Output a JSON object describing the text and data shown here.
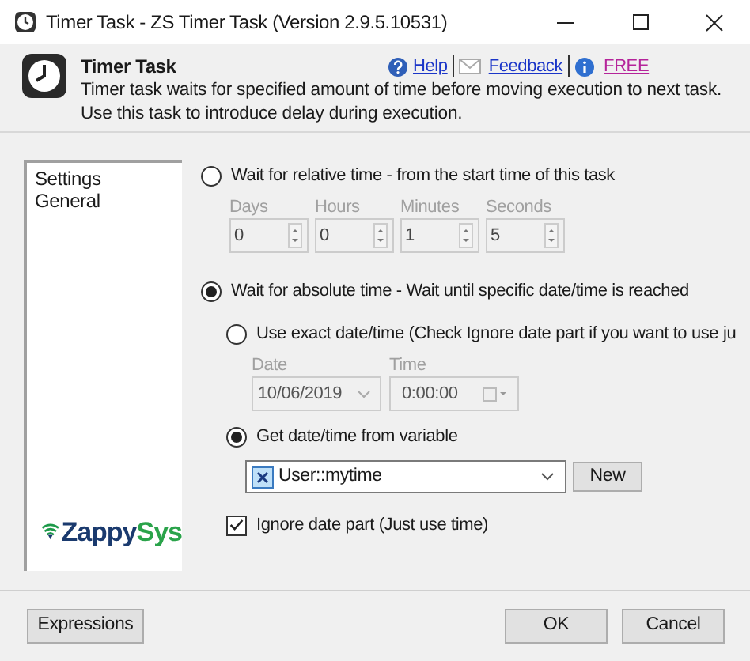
{
  "window": {
    "title": "Timer Task - ZS Timer Task (Version 2.9.5.10531)"
  },
  "header": {
    "title": "Timer Task",
    "description": "Timer task waits for specified amount of time before moving execution to next task. Use this task to introduce delay during execution.",
    "links": [
      {
        "kind": "help",
        "label": "Help"
      },
      {
        "kind": "feedback",
        "label": "Feedback"
      },
      {
        "kind": "info",
        "label": "FREE"
      }
    ]
  },
  "sidebar": {
    "items": [
      {
        "label": "Settings",
        "selected": false
      },
      {
        "label": "General",
        "selected": false
      }
    ],
    "logo": {
      "part_1": "Zappy",
      "part_2": "Sys"
    }
  },
  "relative": {
    "label": "Wait for relative time - from the start time of this task",
    "selected": false,
    "spinners": [
      {
        "label": "Days",
        "value": "0",
        "disabled": true
      },
      {
        "label": "Hours",
        "value": "0",
        "disabled": true
      },
      {
        "label": "Minutes",
        "value": "1",
        "disabled": true
      },
      {
        "label": "Seconds",
        "value": "5",
        "disabled": true
      }
    ]
  },
  "absolute": {
    "label": "Wait for absolute time - Wait until specific date/time is reached",
    "selected": true,
    "exact": {
      "label": "Use exact date/time (Check Ignore date part if you want to use ju",
      "selected": false,
      "date_label": "Date",
      "date": "10/06/2019",
      "time_label": "Time",
      "time": "0:00:00",
      "disabled": true
    },
    "variable": {
      "label": "Get date/time from variable",
      "selected": true,
      "value": "User::mytime",
      "new_button": "New"
    },
    "ignore_date": {
      "label": "Ignore date part (Just use time)",
      "checked": true
    }
  },
  "buttons": {
    "expressions": "Expressions",
    "ok": "OK",
    "cancel": "Cancel"
  }
}
